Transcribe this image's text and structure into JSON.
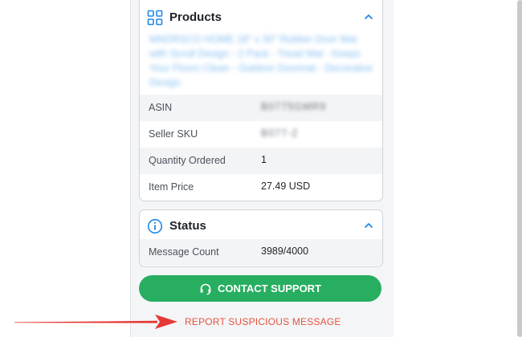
{
  "products": {
    "title": "Products",
    "product_name": "MNDRSCO HOME 18\" x 30\" Rubber Door Mat with Scroll Design - 2 Pack - Tread Mat - Keeps Your Floors Clean - Outdoor Doormat - Decorative Design",
    "rows": [
      {
        "label": "ASIN",
        "value": "B0775GMR9"
      },
      {
        "label": "Seller SKU",
        "value": "B077-2"
      },
      {
        "label": "Quantity Ordered",
        "value": "1"
      },
      {
        "label": "Item Price",
        "value": "27.49 USD"
      }
    ]
  },
  "status": {
    "title": "Status",
    "rows": [
      {
        "label": "Message Count",
        "value": "3989/4000"
      }
    ]
  },
  "actions": {
    "contact_support": "CONTACT SUPPORT",
    "report_suspicious": "REPORT SUSPICIOUS MESSAGE"
  },
  "colors": {
    "accent_blue": "#1e88e5",
    "support_green": "#27ae60",
    "report_red": "#e5533d"
  },
  "icons": {
    "products": "grid-icon",
    "status": "info-icon",
    "collapse": "chevron-up-icon",
    "support": "headset-icon",
    "annotation": "red-arrow"
  }
}
